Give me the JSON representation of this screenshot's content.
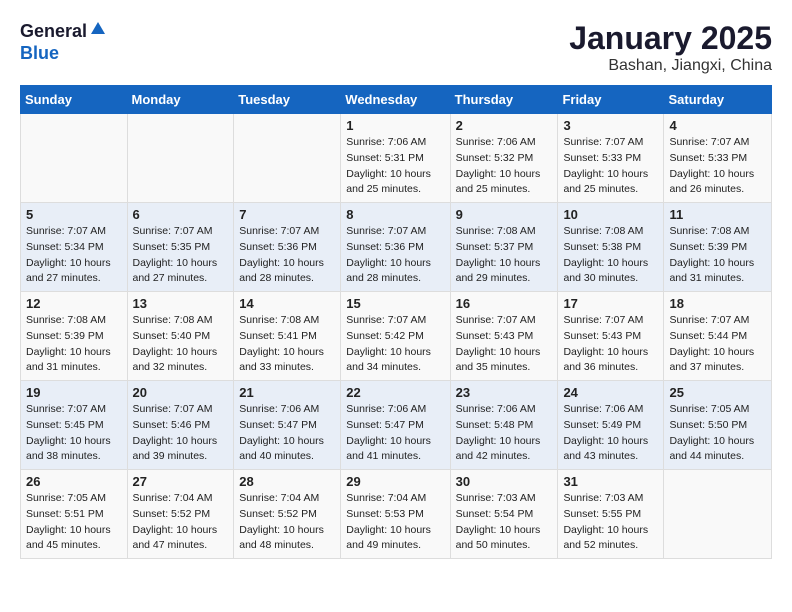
{
  "logo": {
    "general": "General",
    "blue": "Blue"
  },
  "title": "January 2025",
  "subtitle": "Bashan, Jiangxi, China",
  "days_of_week": [
    "Sunday",
    "Monday",
    "Tuesday",
    "Wednesday",
    "Thursday",
    "Friday",
    "Saturday"
  ],
  "weeks": [
    [
      {
        "day": "",
        "info": ""
      },
      {
        "day": "",
        "info": ""
      },
      {
        "day": "",
        "info": ""
      },
      {
        "day": "1",
        "info": "Sunrise: 7:06 AM\nSunset: 5:31 PM\nDaylight: 10 hours\nand 25 minutes."
      },
      {
        "day": "2",
        "info": "Sunrise: 7:06 AM\nSunset: 5:32 PM\nDaylight: 10 hours\nand 25 minutes."
      },
      {
        "day": "3",
        "info": "Sunrise: 7:07 AM\nSunset: 5:33 PM\nDaylight: 10 hours\nand 25 minutes."
      },
      {
        "day": "4",
        "info": "Sunrise: 7:07 AM\nSunset: 5:33 PM\nDaylight: 10 hours\nand 26 minutes."
      }
    ],
    [
      {
        "day": "5",
        "info": "Sunrise: 7:07 AM\nSunset: 5:34 PM\nDaylight: 10 hours\nand 27 minutes."
      },
      {
        "day": "6",
        "info": "Sunrise: 7:07 AM\nSunset: 5:35 PM\nDaylight: 10 hours\nand 27 minutes."
      },
      {
        "day": "7",
        "info": "Sunrise: 7:07 AM\nSunset: 5:36 PM\nDaylight: 10 hours\nand 28 minutes."
      },
      {
        "day": "8",
        "info": "Sunrise: 7:07 AM\nSunset: 5:36 PM\nDaylight: 10 hours\nand 28 minutes."
      },
      {
        "day": "9",
        "info": "Sunrise: 7:08 AM\nSunset: 5:37 PM\nDaylight: 10 hours\nand 29 minutes."
      },
      {
        "day": "10",
        "info": "Sunrise: 7:08 AM\nSunset: 5:38 PM\nDaylight: 10 hours\nand 30 minutes."
      },
      {
        "day": "11",
        "info": "Sunrise: 7:08 AM\nSunset: 5:39 PM\nDaylight: 10 hours\nand 31 minutes."
      }
    ],
    [
      {
        "day": "12",
        "info": "Sunrise: 7:08 AM\nSunset: 5:39 PM\nDaylight: 10 hours\nand 31 minutes."
      },
      {
        "day": "13",
        "info": "Sunrise: 7:08 AM\nSunset: 5:40 PM\nDaylight: 10 hours\nand 32 minutes."
      },
      {
        "day": "14",
        "info": "Sunrise: 7:08 AM\nSunset: 5:41 PM\nDaylight: 10 hours\nand 33 minutes."
      },
      {
        "day": "15",
        "info": "Sunrise: 7:07 AM\nSunset: 5:42 PM\nDaylight: 10 hours\nand 34 minutes."
      },
      {
        "day": "16",
        "info": "Sunrise: 7:07 AM\nSunset: 5:43 PM\nDaylight: 10 hours\nand 35 minutes."
      },
      {
        "day": "17",
        "info": "Sunrise: 7:07 AM\nSunset: 5:43 PM\nDaylight: 10 hours\nand 36 minutes."
      },
      {
        "day": "18",
        "info": "Sunrise: 7:07 AM\nSunset: 5:44 PM\nDaylight: 10 hours\nand 37 minutes."
      }
    ],
    [
      {
        "day": "19",
        "info": "Sunrise: 7:07 AM\nSunset: 5:45 PM\nDaylight: 10 hours\nand 38 minutes."
      },
      {
        "day": "20",
        "info": "Sunrise: 7:07 AM\nSunset: 5:46 PM\nDaylight: 10 hours\nand 39 minutes."
      },
      {
        "day": "21",
        "info": "Sunrise: 7:06 AM\nSunset: 5:47 PM\nDaylight: 10 hours\nand 40 minutes."
      },
      {
        "day": "22",
        "info": "Sunrise: 7:06 AM\nSunset: 5:47 PM\nDaylight: 10 hours\nand 41 minutes."
      },
      {
        "day": "23",
        "info": "Sunrise: 7:06 AM\nSunset: 5:48 PM\nDaylight: 10 hours\nand 42 minutes."
      },
      {
        "day": "24",
        "info": "Sunrise: 7:06 AM\nSunset: 5:49 PM\nDaylight: 10 hours\nand 43 minutes."
      },
      {
        "day": "25",
        "info": "Sunrise: 7:05 AM\nSunset: 5:50 PM\nDaylight: 10 hours\nand 44 minutes."
      }
    ],
    [
      {
        "day": "26",
        "info": "Sunrise: 7:05 AM\nSunset: 5:51 PM\nDaylight: 10 hours\nand 45 minutes."
      },
      {
        "day": "27",
        "info": "Sunrise: 7:04 AM\nSunset: 5:52 PM\nDaylight: 10 hours\nand 47 minutes."
      },
      {
        "day": "28",
        "info": "Sunrise: 7:04 AM\nSunset: 5:52 PM\nDaylight: 10 hours\nand 48 minutes."
      },
      {
        "day": "29",
        "info": "Sunrise: 7:04 AM\nSunset: 5:53 PM\nDaylight: 10 hours\nand 49 minutes."
      },
      {
        "day": "30",
        "info": "Sunrise: 7:03 AM\nSunset: 5:54 PM\nDaylight: 10 hours\nand 50 minutes."
      },
      {
        "day": "31",
        "info": "Sunrise: 7:03 AM\nSunset: 5:55 PM\nDaylight: 10 hours\nand 52 minutes."
      },
      {
        "day": "",
        "info": ""
      }
    ]
  ]
}
